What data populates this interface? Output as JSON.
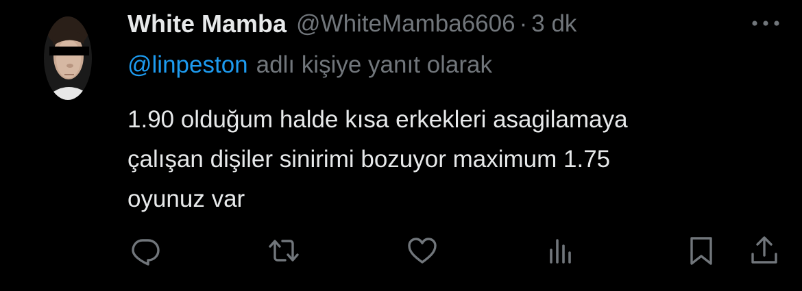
{
  "author": {
    "display_name": "White Mamba",
    "handle": "@WhiteMamba6606",
    "separator": "·",
    "time": "3 dk"
  },
  "reply_context": {
    "mention": "@linpeston",
    "suffix": "adlı kişiye yanıt olarak"
  },
  "body": {
    "lines": [
      "1.90 olduğum halde kısa erkekleri asagilamaya",
      "çalışan dişiler sinirimi bozuyor maximum 1.75",
      "oyunuz var"
    ]
  },
  "icons": {
    "more": "more-horizontal-icon",
    "reply": "reply-icon",
    "retweet": "retweet-icon",
    "like": "heart-icon",
    "views": "analytics-icon",
    "bookmark": "bookmark-icon",
    "share": "share-icon"
  },
  "colors": {
    "background": "#000000",
    "primary_text": "#e7e9ea",
    "secondary_text": "#71767b",
    "accent": "#1d9bf0"
  }
}
